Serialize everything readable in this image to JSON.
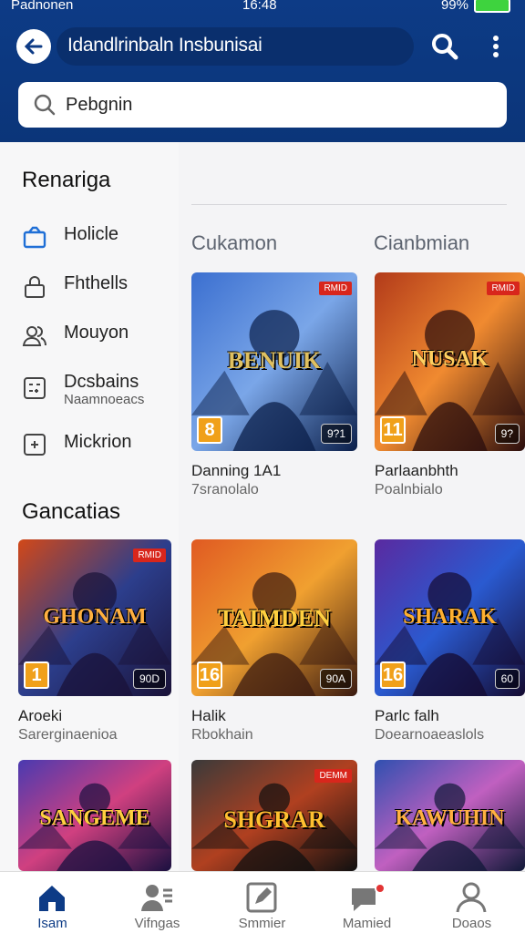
{
  "status": {
    "carrier": "Padnonen",
    "time": "16:48",
    "battery": "99%"
  },
  "header": {
    "title": "Idandlrinbaln Insbunisai"
  },
  "search": {
    "value": "Pebgnin"
  },
  "sidebar": {
    "title": "Renariga",
    "items": [
      {
        "label": "Holicle",
        "icon": "bag-icon"
      },
      {
        "label": "Fhthells",
        "icon": "lock-icon"
      },
      {
        "label": "Mouyon",
        "icon": "people-icon"
      },
      {
        "label": "Dcsbains",
        "sub": "Naamnoeacs",
        "icon": "calculator-icon"
      },
      {
        "label": "Mickrion",
        "icon": "plus-box-icon"
      }
    ]
  },
  "sections": {
    "left": "Cukamon",
    "right": "Cianbmian"
  },
  "grid_title": "Gancatias",
  "top_cards": [
    {
      "cover": "BENUIK",
      "tag": "RMID",
      "age": "8",
      "rating": "9?1",
      "caption": "Danning 1A1",
      "sub": "7sranolalo"
    },
    {
      "cover": "NUSAK",
      "tag": "RMID",
      "age": "11",
      "rating": "9?",
      "caption": "Parlaanbhth",
      "sub": "Poalnbialo"
    }
  ],
  "grid_cards": [
    {
      "cover": "GHONAM",
      "tag": "RMID",
      "age": "1",
      "rating": "90D",
      "caption": "Aroeki",
      "sub": "Sarerginaenioa"
    },
    {
      "cover": "TAIMDEN",
      "tag": "",
      "age": "16",
      "rating": "90A",
      "caption": "Halik",
      "sub": "Rbokhain"
    },
    {
      "cover": "SHARAK",
      "tag": "",
      "age": "16",
      "rating": "60",
      "caption": "Parlc falh",
      "sub": "Doearnoaeaslols"
    },
    {
      "cover": "SANGEME",
      "tag": "",
      "age": "",
      "rating": "",
      "caption": "",
      "sub": ""
    },
    {
      "cover": "SHGRAR",
      "tag": "DEMM",
      "age": "",
      "rating": "",
      "caption": "",
      "sub": ""
    },
    {
      "cover": "KAWUHIN",
      "tag": "",
      "age": "",
      "rating": "",
      "caption": "",
      "sub": ""
    }
  ],
  "tabs": [
    {
      "label": "Isam",
      "icon": "home-icon"
    },
    {
      "label": "Vifngas",
      "icon": "user-list-icon"
    },
    {
      "label": "Smmier",
      "icon": "edit-icon"
    },
    {
      "label": "Mamied",
      "icon": "chat-icon"
    },
    {
      "label": "Doaos",
      "icon": "profile-icon"
    }
  ]
}
